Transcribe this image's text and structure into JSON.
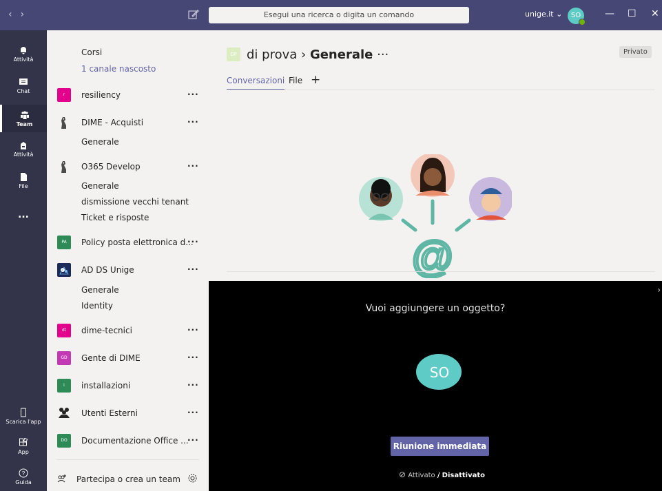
{
  "topbar": {
    "search_placeholder": "Esegui una ricerca o digita un comando",
    "tenant": "unige.it ⌄",
    "avatar_initials": "SO"
  },
  "rail": {
    "items": [
      {
        "label": "Attività",
        "icon": "bell-icon"
      },
      {
        "label": "Chat",
        "icon": "chat-icon"
      },
      {
        "label": "Team",
        "icon": "teams-icon"
      },
      {
        "label": "Attività",
        "icon": "assignments-icon"
      },
      {
        "label": "File",
        "icon": "file-icon"
      },
      {
        "label": "...",
        "icon": "more-icon"
      }
    ],
    "bottom": [
      {
        "label": "Scarica l'app",
        "icon": "phone-icon"
      },
      {
        "label": "App",
        "icon": "apps-icon"
      },
      {
        "label": "Guida",
        "icon": "help-icon"
      }
    ]
  },
  "teams": {
    "top": {
      "label": "Corsi",
      "hidden": "1 canale nascosto"
    },
    "list": [
      {
        "name": "resiliency",
        "initials": "r",
        "color": "#e3008c"
      },
      {
        "name": "DIME - Acquisti",
        "initials": "",
        "color": "#ffffff",
        "channels": [
          "Generale"
        ]
      },
      {
        "name": "O365 Develop",
        "initials": "",
        "color": "#ffffff",
        "channels": [
          "Generale",
          "dismissione vecchi tenant",
          "Ticket e risposte"
        ]
      },
      {
        "name": "Policy posta elettronica d...",
        "initials": "PA",
        "color": "#2e8b57"
      },
      {
        "name": "AD DS Unige",
        "initials": "",
        "color": "#1b2a57",
        "channels": [
          "Generale",
          "Identity"
        ]
      },
      {
        "name": "dime-tecnici",
        "initials": "dt",
        "color": "#e3008c"
      },
      {
        "name": "Gente di DIME",
        "initials": "GD",
        "color": "#c239b3"
      },
      {
        "name": "installazioni",
        "initials": "i",
        "color": "#2e8b57"
      },
      {
        "name": "Utenti Esterni",
        "initials": "",
        "color": "#ffffff"
      },
      {
        "name": "Documentazione Office ...",
        "initials": "DO",
        "color": "#2e8b57"
      }
    ],
    "footer": "Partecipa o crea un team"
  },
  "main": {
    "team_initials": "DP",
    "team_name": "di prova",
    "channel": "Generale",
    "privacy": "Privato",
    "tabs": [
      "Conversazioni",
      "File"
    ]
  },
  "meeting": {
    "question": "Vuoi aggiungere un oggetto?",
    "avatar": "SO",
    "button": "Riunione immediata",
    "cam_on": "Attivato",
    "sep": "/",
    "cam_off": "Disattivato"
  }
}
